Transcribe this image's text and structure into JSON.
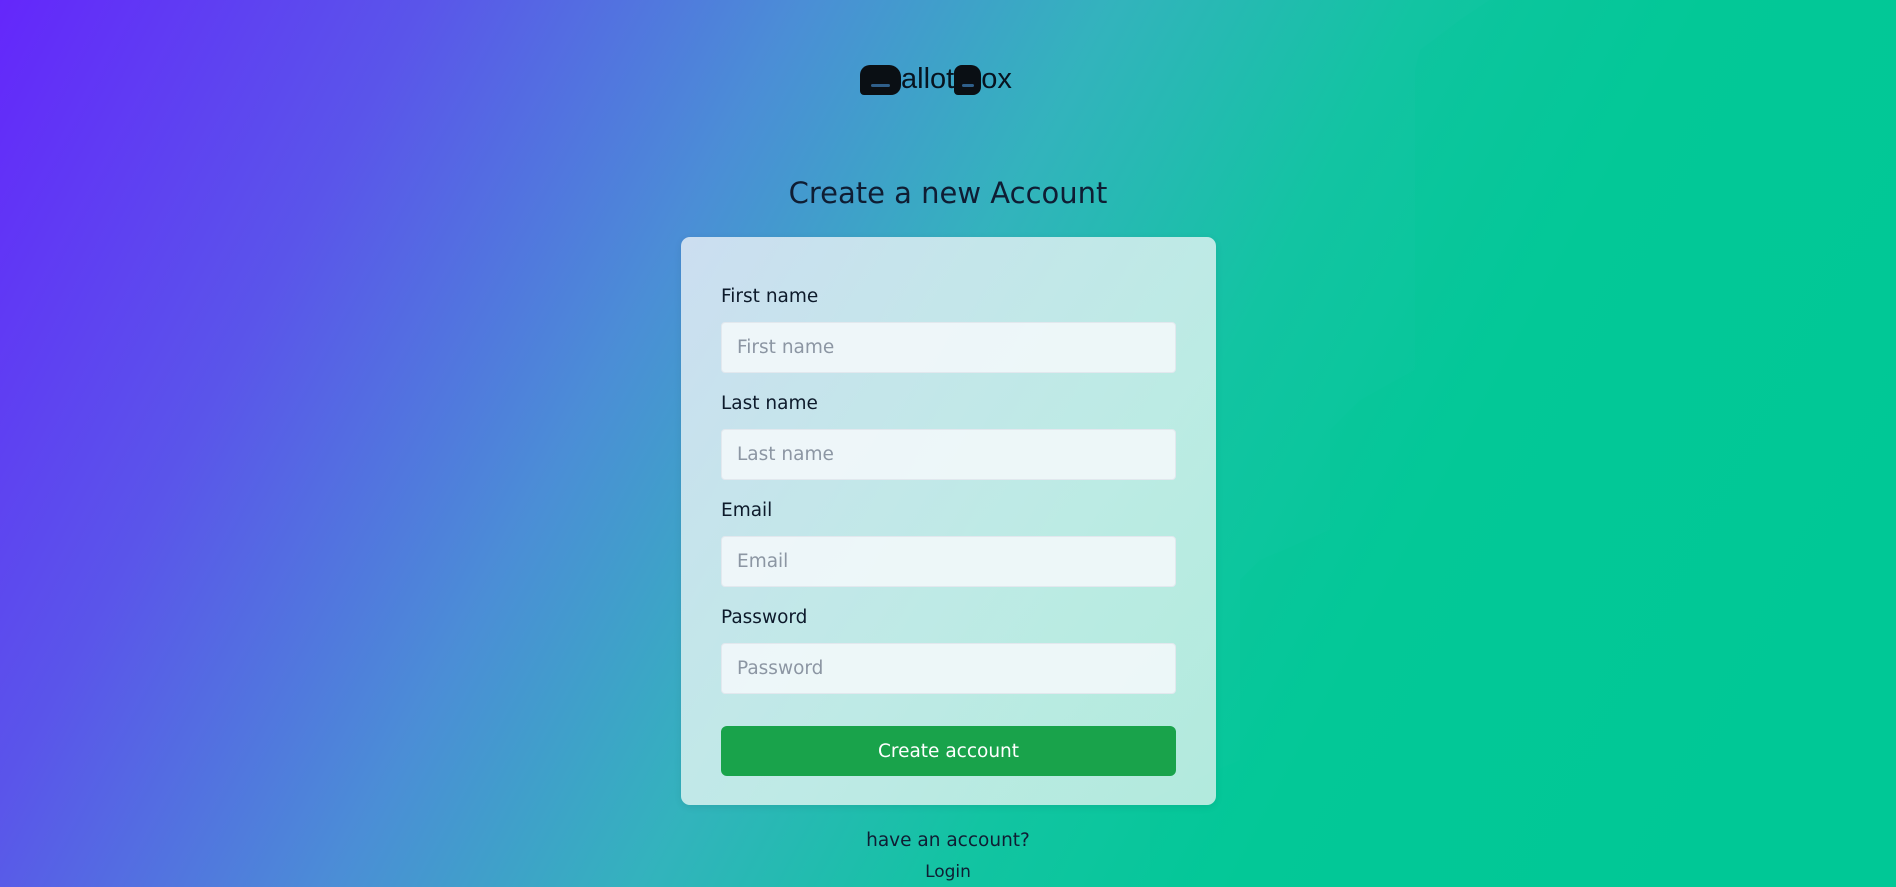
{
  "logo": {
    "text_part1": "allot",
    "text_part2": "ox"
  },
  "form": {
    "title": "Create a new Account",
    "fields": [
      {
        "label": "First name",
        "placeholder": "First name",
        "value": ""
      },
      {
        "label": "Last name",
        "placeholder": "Last name",
        "value": ""
      },
      {
        "label": "Email",
        "placeholder": "Email",
        "value": ""
      },
      {
        "label": "Password",
        "placeholder": "Password",
        "value": ""
      }
    ],
    "submit_label": "Create account"
  },
  "footer": {
    "question": "have an account?",
    "login_link": "Login"
  },
  "colors": {
    "gradient_start": "#6427fb",
    "gradient_end": "#00c997",
    "button_bg": "#19a34b",
    "button_text": "#ffffff",
    "text_dark": "#0f1d33"
  },
  "icons": {
    "logo_b_1": "logo-b-glyph",
    "logo_b_2": "logo-b-glyph"
  }
}
